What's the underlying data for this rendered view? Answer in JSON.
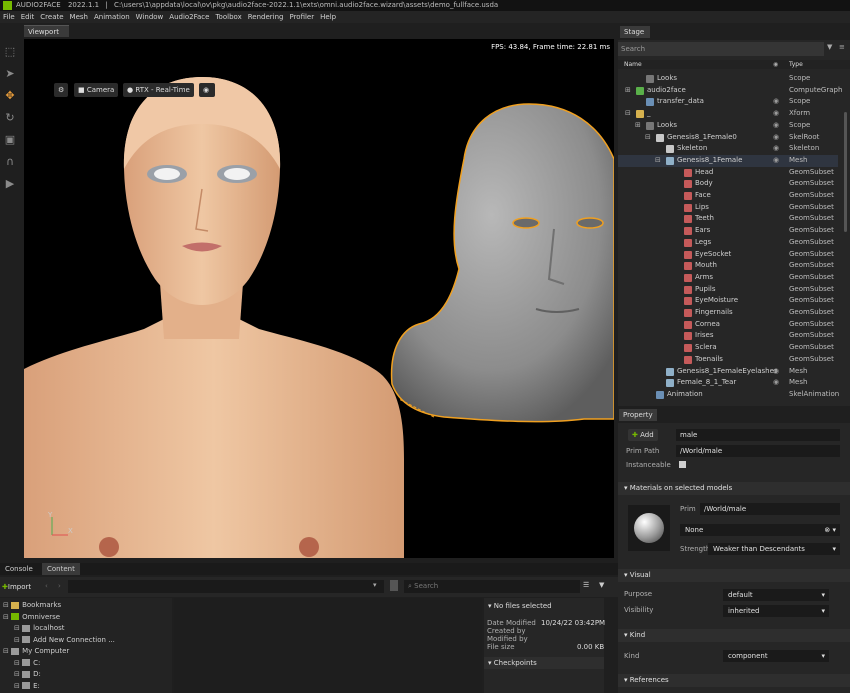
{
  "titlebar": {
    "app": "AUDIO2FACE",
    "version": "2022.1.1",
    "path": "C:\\users\\1\\appdata\\local\\ov\\pkg\\audio2face-2022.1.1\\exts\\omni.audio2face.wizard\\assets\\demo_fullface.usda"
  },
  "menu": [
    "File",
    "Edit",
    "Create",
    "Mesh",
    "Animation",
    "Window",
    "Audio2Face",
    "Toolbox",
    "Rendering",
    "Profiler",
    "Help"
  ],
  "viewport": {
    "tab": "Viewport",
    "camera_label": "Camera",
    "rtx_label": "RTX - Real-Time",
    "fps_text": "FPS: 43.84, Frame time: 22.81 ms",
    "axis_y": "Y",
    "axis_x": "X"
  },
  "stage": {
    "tab": "Stage",
    "search_placeholder": "Search",
    "col_name": "Name",
    "col_type": "Type",
    "rows": [
      {
        "name": "Looks",
        "type": "Scope",
        "eye": false,
        "icon": "#777"
      },
      {
        "name": "audio2face",
        "type": "ComputeGraph",
        "eye": false,
        "icon": "#5ab04a"
      },
      {
        "name": "transfer_data",
        "type": "Scope",
        "eye": true,
        "icon": "#6a8fb5"
      },
      {
        "name": "_",
        "type": "Xform",
        "eye": true,
        "icon": "#d6b14e"
      },
      {
        "name": "Looks",
        "type": "Scope",
        "eye": true,
        "icon": "#777"
      },
      {
        "name": "Genesis8_1Female0",
        "type": "SkelRoot",
        "eye": true,
        "icon": "#c8c8c8"
      },
      {
        "name": "Skeleton",
        "type": "Skeleton",
        "eye": true,
        "icon": "#c8c8c8"
      },
      {
        "name": "Genesis8_1Female",
        "type": "Mesh",
        "eye": true,
        "icon": "#8fb0c8"
      },
      {
        "name": "Head",
        "type": "GeomSubset",
        "eye": false,
        "icon": "#c55a5a"
      },
      {
        "name": "Body",
        "type": "GeomSubset",
        "eye": false,
        "icon": "#c55a5a"
      },
      {
        "name": "Face",
        "type": "GeomSubset",
        "eye": false,
        "icon": "#c55a5a"
      },
      {
        "name": "Lips",
        "type": "GeomSubset",
        "eye": false,
        "icon": "#c55a5a"
      },
      {
        "name": "Teeth",
        "type": "GeomSubset",
        "eye": false,
        "icon": "#c55a5a"
      },
      {
        "name": "Ears",
        "type": "GeomSubset",
        "eye": false,
        "icon": "#c55a5a"
      },
      {
        "name": "Legs",
        "type": "GeomSubset",
        "eye": false,
        "icon": "#c55a5a"
      },
      {
        "name": "EyeSocket",
        "type": "GeomSubset",
        "eye": false,
        "icon": "#c55a5a"
      },
      {
        "name": "Mouth",
        "type": "GeomSubset",
        "eye": false,
        "icon": "#c55a5a"
      },
      {
        "name": "Arms",
        "type": "GeomSubset",
        "eye": false,
        "icon": "#c55a5a"
      },
      {
        "name": "Pupils",
        "type": "GeomSubset",
        "eye": false,
        "icon": "#c55a5a"
      },
      {
        "name": "EyeMoisture",
        "type": "GeomSubset",
        "eye": false,
        "icon": "#c55a5a"
      },
      {
        "name": "Fingernails",
        "type": "GeomSubset",
        "eye": false,
        "icon": "#c55a5a"
      },
      {
        "name": "Cornea",
        "type": "GeomSubset",
        "eye": false,
        "icon": "#c55a5a"
      },
      {
        "name": "Irises",
        "type": "GeomSubset",
        "eye": false,
        "icon": "#c55a5a"
      },
      {
        "name": "Sclera",
        "type": "GeomSubset",
        "eye": false,
        "icon": "#c55a5a"
      },
      {
        "name": "Toenails",
        "type": "GeomSubset",
        "eye": false,
        "icon": "#c55a5a"
      },
      {
        "name": "Genesis8_1FemaleEyelashes",
        "type": "Mesh",
        "eye": true,
        "icon": "#8fb0c8"
      },
      {
        "name": "Female_8_1_Tear",
        "type": "Mesh",
        "eye": true,
        "icon": "#8fb0c8"
      },
      {
        "name": "Animation",
        "type": "SkelAnimation",
        "eye": false,
        "icon": "#6a8fb5"
      }
    ]
  },
  "property": {
    "tab": "Property",
    "add_label": "Add",
    "name_value": "male",
    "prim_path_label": "Prim Path",
    "prim_path_value": "/World/male",
    "instanceable_label": "Instanceable",
    "materials_header": "Materials on selected models",
    "prim_label": "Prim",
    "prim_value": "/World/male",
    "material_value": "None",
    "strength_label": "Strength",
    "strength_value": "Weaker than Descendants",
    "visual_header": "Visual",
    "purpose_label": "Purpose",
    "purpose_value": "default",
    "visibility_label": "Visibility",
    "visibility_value": "inherited",
    "kind_header": "Kind",
    "kind_label": "Kind",
    "kind_value": "component",
    "references_header": "References"
  },
  "bottom": {
    "console_tab": "Console",
    "content_tab": "Content",
    "import_label": "Import",
    "search_placeholder": "Search",
    "tree": [
      {
        "label": "Bookmarks",
        "indent": 0,
        "icon": "#d6b14e"
      },
      {
        "label": "Omniverse",
        "indent": 0,
        "icon": "#76b900"
      },
      {
        "label": "localhost",
        "indent": 1,
        "icon": "#9a9a9a"
      },
      {
        "label": "Add New Connection ...",
        "indent": 1,
        "icon": "#9a9a9a"
      },
      {
        "label": "My Computer",
        "indent": 0,
        "icon": "#9a9a9a"
      },
      {
        "label": "C:",
        "indent": 1,
        "icon": "#9a9a9a"
      },
      {
        "label": "D:",
        "indent": 1,
        "icon": "#9a9a9a"
      },
      {
        "label": "E:",
        "indent": 1,
        "icon": "#9a9a9a"
      }
    ],
    "details_header": "No files selected",
    "date_modified_label": "Date Modified",
    "date_modified_value": "10/24/22 03:42PM",
    "created_by_label": "Created by",
    "modified_by_label": "Modified by",
    "file_size_label": "File size",
    "file_size_value": "0.00 KB",
    "checkpoints_header": "Checkpoints"
  }
}
